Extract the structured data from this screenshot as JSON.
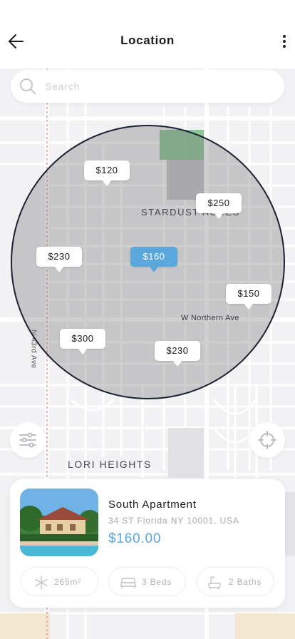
{
  "header": {
    "title": "Location"
  },
  "search": {
    "placeholder": "Search",
    "value": ""
  },
  "map": {
    "labels": {
      "street_vertical": "N 43rd Ave",
      "street_horizontal": "W Northern Ave",
      "area_1": "STARDUST ACRES",
      "area_2": "LORI HEIGHTS"
    },
    "pins": [
      {
        "price": "$120",
        "active": false
      },
      {
        "price": "$250",
        "active": false
      },
      {
        "price": "$230",
        "active": false
      },
      {
        "price": "$160",
        "active": true
      },
      {
        "price": "$150",
        "active": false
      },
      {
        "price": "$300",
        "active": false
      },
      {
        "price": "$230",
        "active": false
      }
    ]
  },
  "listing": {
    "name": "South Apartment",
    "address": "34 ST Florida NY 10001, USA",
    "price": "$160.00",
    "area": "265m²",
    "beds": "3 Beds",
    "baths": "2 Baths"
  },
  "colors": {
    "accent": "#5aa7dc",
    "text": "#1b1b1f",
    "muted": "#a9a9b0",
    "circle_border": "#1b2233"
  },
  "icons": {
    "back": "arrow-left-icon",
    "more": "more-vertical-icon",
    "search": "search-icon",
    "filter": "sliders-icon",
    "locate": "crosshair-icon",
    "area": "snowflake-area-icon",
    "beds": "bed-icon",
    "baths": "bathtub-icon"
  }
}
